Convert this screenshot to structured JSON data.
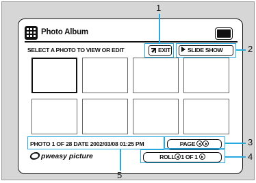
{
  "header": {
    "app_title": "Photo Album",
    "app_icon": "grid-icon",
    "battery_icon": "battery-icon"
  },
  "toolbar": {
    "instruction": "SELECT A PHOTO TO VIEW OR EDIT",
    "exit_label": "EXIT",
    "slideshow_label": "SLIDE SHOW"
  },
  "thumbnails": {
    "rows": 2,
    "columns": 4,
    "selected_index": 0
  },
  "status": {
    "info": "PHOTO 1 OF 28 DATE 2002/03/08  01:25 PM",
    "page_label": "PAGE",
    "roll_prefix": "ROLL",
    "roll_text": "1  OF  1"
  },
  "brand": {
    "logo_text": "pweasy picture"
  },
  "callouts": {
    "c1": "1",
    "c2": "2",
    "c3": "3",
    "c4": "4",
    "c5": "5"
  },
  "colors": {
    "highlight": "#29a9e1",
    "ink": "#111111"
  }
}
